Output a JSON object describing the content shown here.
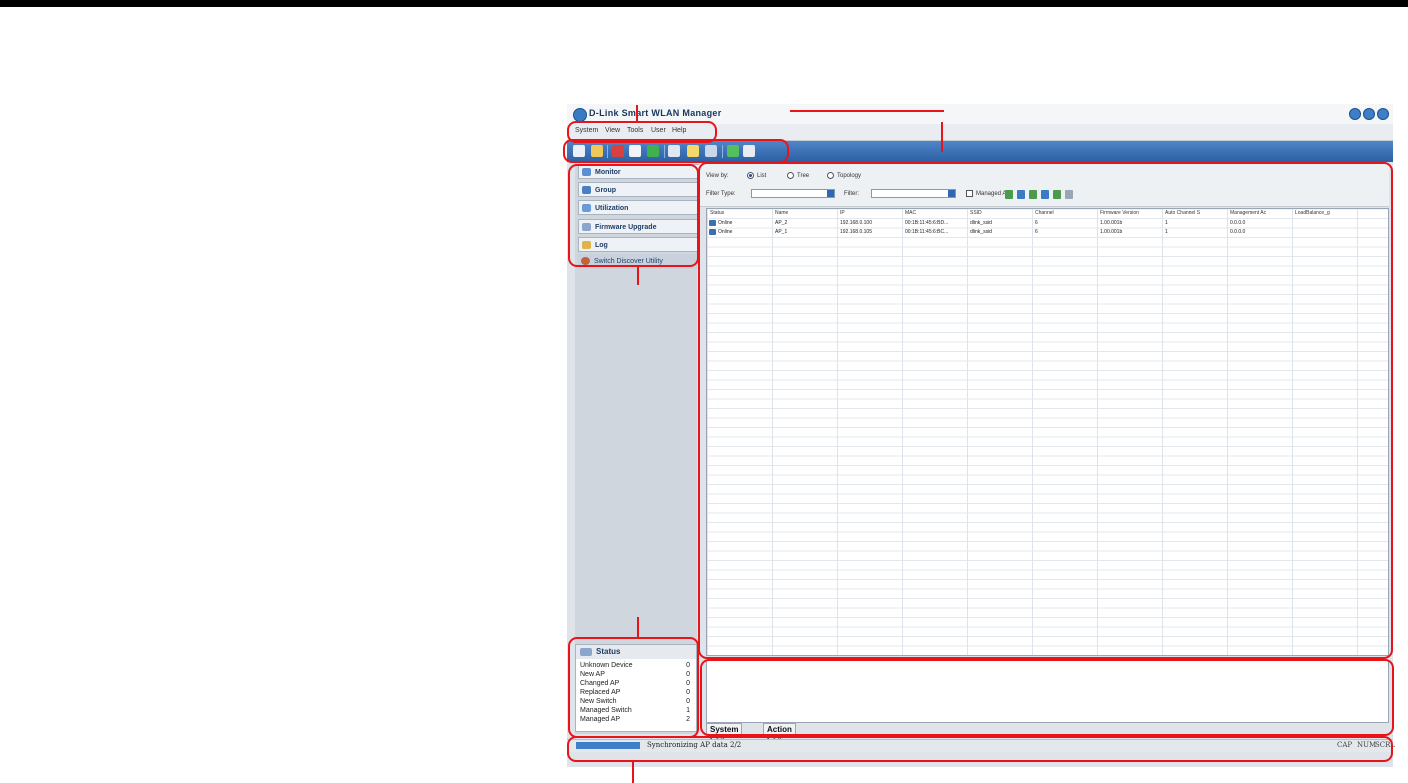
{
  "window": {
    "title": "D-Link Smart WLAN Manager"
  },
  "menubar": {
    "items": [
      "System",
      "View",
      "Tools",
      "User",
      "Help"
    ]
  },
  "toolbar": {
    "buttons": [
      "search-icon",
      "folder-icon",
      "save-icon",
      "refresh-icon",
      "apply-icon",
      "document-icon",
      "edit-icon",
      "copy-icon",
      "check-icon",
      "help-icon"
    ]
  },
  "sidebar": {
    "items": [
      {
        "label": "Monitor",
        "icon": "monitor-icon"
      },
      {
        "label": "Group",
        "icon": "group-icon"
      },
      {
        "label": "Utilization",
        "icon": "utilization-icon"
      },
      {
        "label": "Firmware Upgrade",
        "icon": "firmware-icon"
      },
      {
        "label": "Log",
        "icon": "log-icon"
      },
      {
        "label": "Switch Discover Utility",
        "icon": "discover-icon"
      }
    ]
  },
  "status_panel": {
    "title": "Status",
    "rows": [
      {
        "label": "Unknown Device",
        "value": "0"
      },
      {
        "label": "New AP",
        "value": "0"
      },
      {
        "label": "Changed AP",
        "value": "0"
      },
      {
        "label": "Replaced AP",
        "value": "0"
      },
      {
        "label": "New Switch",
        "value": "0"
      },
      {
        "label": "Managed Switch",
        "value": "1"
      },
      {
        "label": "Managed AP",
        "value": "2"
      }
    ]
  },
  "filter": {
    "view_by_label": "View by:",
    "view_options": [
      "List",
      "Tree",
      "Topology"
    ],
    "selected_view": "List",
    "filter_type_label": "Filter Type:",
    "filter_label": "Filter:",
    "managed_ap_label": "Managed AP"
  },
  "table": {
    "columns": [
      "Status",
      "Name",
      "IP",
      "MAC",
      "SSID",
      "Channel",
      "Firmware Version",
      "Auto Channel S",
      "Management Ac",
      "LoadBalance_g"
    ],
    "rows": [
      [
        "Online",
        "AP_2",
        "192.168.0.100",
        "00:1B:11:45:6:BD...",
        "dlink_ssid",
        "6",
        "1.00.001b",
        "1",
        "0.0.0.0",
        ""
      ],
      [
        "Online",
        "AP_1",
        "192.168.0.105",
        "00:1B:11:45:6:BC...",
        "dlink_ssid",
        "6",
        "1.00.001b",
        "1",
        "0.0.0.0",
        ""
      ]
    ]
  },
  "log_tabs": [
    "System Log",
    "Action Log"
  ],
  "statusbar": {
    "progress": 1.0,
    "message": "Synchronizing AP data 2/2",
    "indicators": [
      "CAP",
      "NUM",
      "SCRL"
    ]
  },
  "colors": {
    "callout": "#e8141a",
    "toolbar": "#2b5fa3",
    "accent": "#3f7ec8"
  }
}
